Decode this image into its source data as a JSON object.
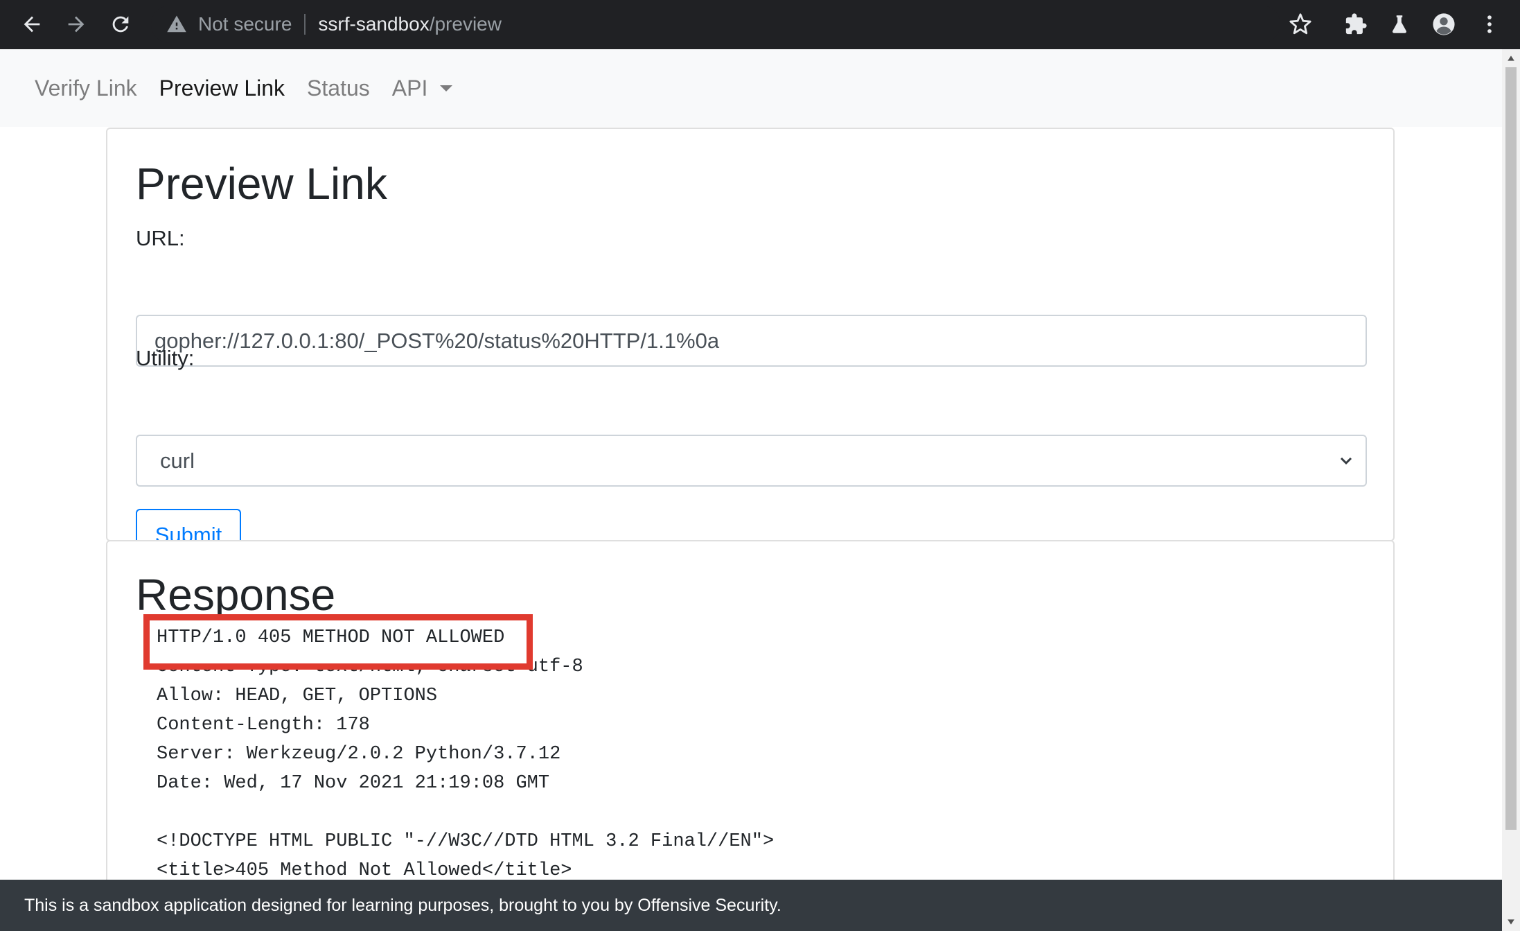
{
  "browser": {
    "security_label": "Not secure",
    "url_host": "ssrf-sandbox",
    "url_path": "/preview",
    "icons": {
      "back": "arrow-left-icon",
      "forward": "arrow-right-icon",
      "reload": "reload-icon",
      "warning": "warning-triangle-icon",
      "bookmark": "star-icon",
      "extensions": "puzzle-icon",
      "labs": "flask-icon",
      "profile": "avatar-icon",
      "menu": "kebab-menu-icon"
    }
  },
  "navbar": {
    "items": [
      {
        "label": "Verify Link",
        "active": false
      },
      {
        "label": "Preview Link",
        "active": true
      },
      {
        "label": "Status",
        "active": false
      },
      {
        "label": "API",
        "active": false,
        "dropdown": true
      }
    ]
  },
  "form": {
    "title": "Preview Link",
    "url_label": "URL:",
    "url_value": "gopher://127.0.0.1:80/_POST%20/status%20HTTP/1.1%0a",
    "utility_label": "Utility:",
    "utility_value": "curl",
    "submit_label": "Submit"
  },
  "response": {
    "title": "Response",
    "highlighted_line": "HTTP/1.0 405 METHOD NOT ALLOWED",
    "body": "Content-Type: text/html; charset=utf-8\nAllow: HEAD, GET, OPTIONS\nContent-Length: 178\nServer: Werkzeug/2.0.2 Python/3.7.12\nDate: Wed, 17 Nov 2021 21:19:08 GMT\n\n<!DOCTYPE HTML PUBLIC \"-//W3C//DTD HTML 3.2 Final//EN\">\n<title>405 Method Not Allowed</title>",
    "highlight_color": "#e03a2f"
  },
  "footer": {
    "text": "This is a sandbox application designed for learning purposes, brought to you by Offensive Security."
  }
}
